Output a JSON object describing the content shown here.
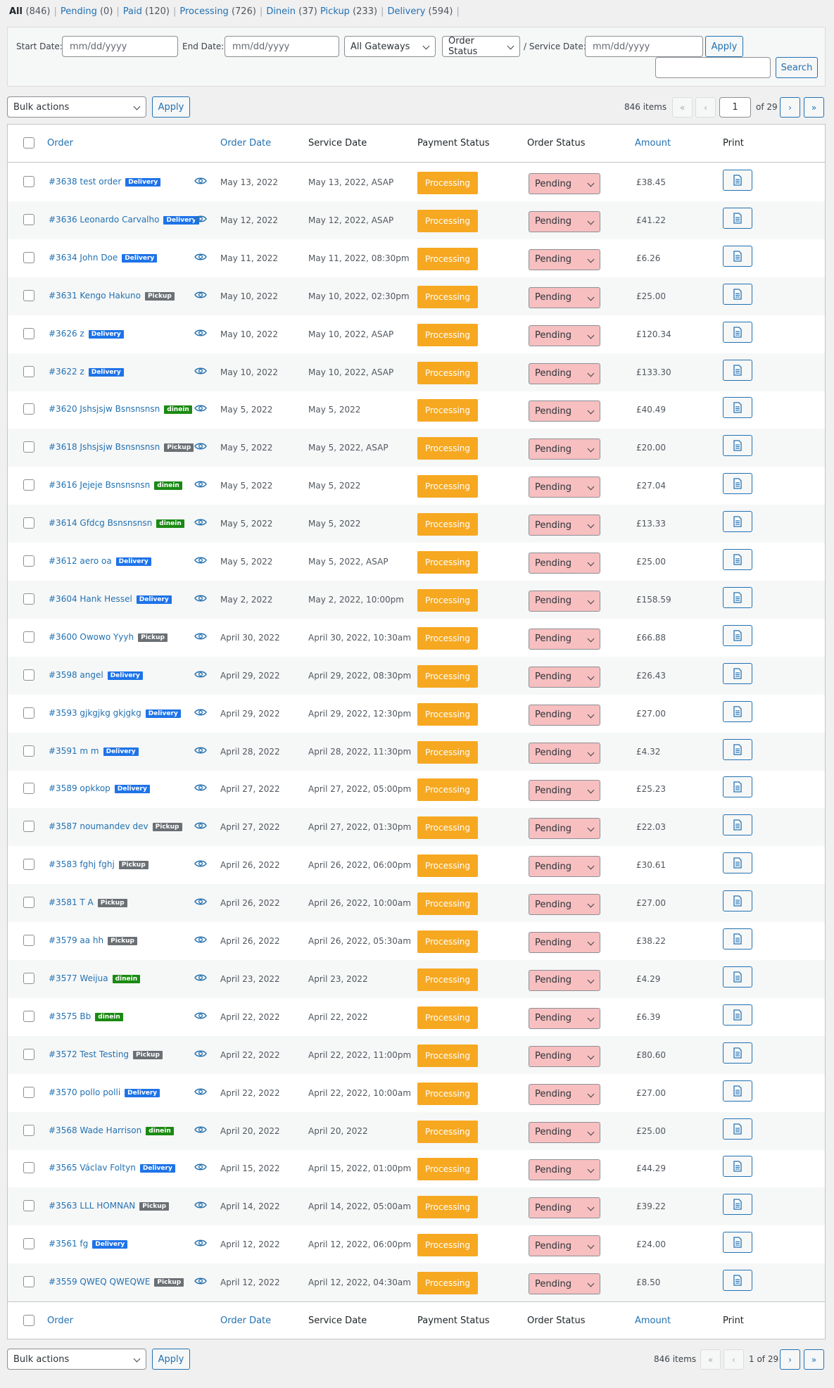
{
  "status_links": [
    {
      "label": "All",
      "count": "(846)"
    },
    {
      "label": "Pending",
      "count": "(0)"
    },
    {
      "label": "Paid",
      "count": "(120)"
    },
    {
      "label": "Processing",
      "count": "(726)"
    },
    {
      "label": "Dinein",
      "count": "(37)"
    },
    {
      "label": "Pickup",
      "count": "(233)"
    },
    {
      "label": "Delivery",
      "count": "(594)"
    }
  ],
  "filters": {
    "start_date_label": "Start Date:",
    "start_date_placeholder": "mm/dd/yyyy",
    "end_date_label": "End Date:",
    "end_date_placeholder": "mm/dd/yyyy",
    "gateway_value": "All Gateways",
    "order_status_value": "Order Status",
    "service_date_label": "/ Service Date:",
    "service_date_placeholder": "mm/dd/yyyy",
    "apply_label": "Apply",
    "search_value": "",
    "search_label": "Search"
  },
  "tablenav_top": {
    "bulk_actions": "Bulk actions",
    "apply_label": "Apply",
    "items": "846 items",
    "first": "«",
    "prev": "‹",
    "current_page": "1",
    "of_pages": "of 29",
    "next": "›",
    "last": "»"
  },
  "tablenav_bottom": {
    "bulk_actions": "Bulk actions",
    "apply_label": "Apply",
    "items": "846 items",
    "first": "«",
    "prev": "‹",
    "page_text": "1 of 29",
    "next": "›",
    "last": "»"
  },
  "columns": {
    "order": "Order",
    "order_date": "Order Date",
    "service_date": "Service Date",
    "payment_status": "Payment Status",
    "order_status": "Order Status",
    "amount": "Amount",
    "print": "Print"
  },
  "colors": {
    "delivery": "#1e73e8",
    "pickup": "#6b7075",
    "dinein": "#1a8a12",
    "processing": "#f6a821",
    "pending": "#f7bfc0",
    "link": "#2271b1"
  },
  "rows": [
    {
      "order": "#3638 test order",
      "type": "Delivery",
      "order_date": "May 13, 2022",
      "service_date": "May 13, 2022, ASAP",
      "payment": "Processing",
      "status": "Pending",
      "amount": "£38.45"
    },
    {
      "order": "#3636 Leonardo Carvalho",
      "type": "Delivery",
      "order_date": "May 12, 2022",
      "service_date": "May 12, 2022, ASAP",
      "payment": "Processing",
      "status": "Pending",
      "amount": "£41.22"
    },
    {
      "order": "#3634 John Doe",
      "type": "Delivery",
      "order_date": "May 11, 2022",
      "service_date": "May 11, 2022, 08:30pm",
      "payment": "Processing",
      "status": "Pending",
      "amount": "£6.26"
    },
    {
      "order": "#3631 Kengo Hakuno",
      "type": "Pickup",
      "order_date": "May 10, 2022",
      "service_date": "May 10, 2022, 02:30pm",
      "payment": "Processing",
      "status": "Pending",
      "amount": "£25.00"
    },
    {
      "order": "#3626 z",
      "type": "Delivery",
      "order_date": "May 10, 2022",
      "service_date": "May 10, 2022, ASAP",
      "payment": "Processing",
      "status": "Pending",
      "amount": "£120.34"
    },
    {
      "order": "#3622 z",
      "type": "Delivery",
      "order_date": "May 10, 2022",
      "service_date": "May 10, 2022, ASAP",
      "payment": "Processing",
      "status": "Pending",
      "amount": "£133.30"
    },
    {
      "order": "#3620 Jshsjsjw Bsnsnsnsn",
      "type": "dinein",
      "order_date": "May 5, 2022",
      "service_date": "May 5, 2022",
      "payment": "Processing",
      "status": "Pending",
      "amount": "£40.49"
    },
    {
      "order": "#3618 Jshsjsjw Bsnsnsnsn",
      "type": "Pickup",
      "order_date": "May 5, 2022",
      "service_date": "May 5, 2022, ASAP",
      "payment": "Processing",
      "status": "Pending",
      "amount": "£20.00"
    },
    {
      "order": "#3616 Jejeje Bsnsnsnsn",
      "type": "dinein",
      "order_date": "May 5, 2022",
      "service_date": "May 5, 2022",
      "payment": "Processing",
      "status": "Pending",
      "amount": "£27.04"
    },
    {
      "order": "#3614 Gfdcg Bsnsnsnsn",
      "type": "dinein",
      "order_date": "May 5, 2022",
      "service_date": "May 5, 2022",
      "payment": "Processing",
      "status": "Pending",
      "amount": "£13.33"
    },
    {
      "order": "#3612 aero oa",
      "type": "Delivery",
      "order_date": "May 5, 2022",
      "service_date": "May 5, 2022, ASAP",
      "payment": "Processing",
      "status": "Pending",
      "amount": "£25.00"
    },
    {
      "order": "#3604 Hank Hessel",
      "type": "Delivery",
      "order_date": "May 2, 2022",
      "service_date": "May 2, 2022, 10:00pm",
      "payment": "Processing",
      "status": "Pending",
      "amount": "£158.59"
    },
    {
      "order": "#3600 Owowo Yyyh",
      "type": "Pickup",
      "order_date": "April 30, 2022",
      "service_date": "April 30, 2022, 10:30am",
      "payment": "Processing",
      "status": "Pending",
      "amount": "£66.88"
    },
    {
      "order": "#3598 angel",
      "type": "Delivery",
      "order_date": "April 29, 2022",
      "service_date": "April 29, 2022, 08:30pm",
      "payment": "Processing",
      "status": "Pending",
      "amount": "£26.43"
    },
    {
      "order": "#3593 gjkgjkg gkjgkg",
      "type": "Delivery",
      "order_date": "April 29, 2022",
      "service_date": "April 29, 2022, 12:30pm",
      "payment": "Processing",
      "status": "Pending",
      "amount": "£27.00"
    },
    {
      "order": "#3591 m m",
      "type": "Delivery",
      "order_date": "April 28, 2022",
      "service_date": "April 28, 2022, 11:30pm",
      "payment": "Processing",
      "status": "Pending",
      "amount": "£4.32"
    },
    {
      "order": "#3589 opkkop",
      "type": "Delivery",
      "order_date": "April 27, 2022",
      "service_date": "April 27, 2022, 05:00pm",
      "payment": "Processing",
      "status": "Pending",
      "amount": "£25.23"
    },
    {
      "order": "#3587 noumandev dev",
      "type": "Pickup",
      "order_date": "April 27, 2022",
      "service_date": "April 27, 2022, 01:30pm",
      "payment": "Processing",
      "status": "Pending",
      "amount": "£22.03"
    },
    {
      "order": "#3583 fghj fghj",
      "type": "Pickup",
      "order_date": "April 26, 2022",
      "service_date": "April 26, 2022, 06:00pm",
      "payment": "Processing",
      "status": "Pending",
      "amount": "£30.61"
    },
    {
      "order": "#3581 T A",
      "type": "Pickup",
      "order_date": "April 26, 2022",
      "service_date": "April 26, 2022, 10:00am",
      "payment": "Processing",
      "status": "Pending",
      "amount": "£27.00"
    },
    {
      "order": "#3579 aa hh",
      "type": "Pickup",
      "order_date": "April 26, 2022",
      "service_date": "April 26, 2022, 05:30am",
      "payment": "Processing",
      "status": "Pending",
      "amount": "£38.22"
    },
    {
      "order": "#3577 Weijua",
      "type": "dinein",
      "order_date": "April 23, 2022",
      "service_date": "April 23, 2022",
      "payment": "Processing",
      "status": "Pending",
      "amount": "£4.29"
    },
    {
      "order": "#3575 Bb",
      "type": "dinein",
      "order_date": "April 22, 2022",
      "service_date": "April 22, 2022",
      "payment": "Processing",
      "status": "Pending",
      "amount": "£6.39"
    },
    {
      "order": "#3572 Test Testing",
      "type": "Pickup",
      "order_date": "April 22, 2022",
      "service_date": "April 22, 2022, 11:00pm",
      "payment": "Processing",
      "status": "Pending",
      "amount": "£80.60"
    },
    {
      "order": "#3570 pollo polli",
      "type": "Delivery",
      "order_date": "April 22, 2022",
      "service_date": "April 22, 2022, 10:00am",
      "payment": "Processing",
      "status": "Pending",
      "amount": "£27.00"
    },
    {
      "order": "#3568 Wade Harrison",
      "type": "dinein",
      "order_date": "April 20, 2022",
      "service_date": "April 20, 2022",
      "payment": "Processing",
      "status": "Pending",
      "amount": "£25.00"
    },
    {
      "order": "#3565 Václav Foltyn",
      "type": "Delivery",
      "order_date": "April 15, 2022",
      "service_date": "April 15, 2022, 01:00pm",
      "payment": "Processing",
      "status": "Pending",
      "amount": "£44.29"
    },
    {
      "order": "#3563 LLL HOMNAN",
      "type": "Pickup",
      "order_date": "April 14, 2022",
      "service_date": "April 14, 2022, 05:00am",
      "payment": "Processing",
      "status": "Pending",
      "amount": "£39.22"
    },
    {
      "order": "#3561 fg",
      "type": "Delivery",
      "order_date": "April 12, 2022",
      "service_date": "April 12, 2022, 06:00pm",
      "payment": "Processing",
      "status": "Pending",
      "amount": "£24.00"
    },
    {
      "order": "#3559 QWEQ QWEQWE",
      "type": "Pickup",
      "order_date": "April 12, 2022",
      "service_date": "April 12, 2022, 04:30am",
      "payment": "Processing",
      "status": "Pending",
      "amount": "£8.50"
    }
  ]
}
